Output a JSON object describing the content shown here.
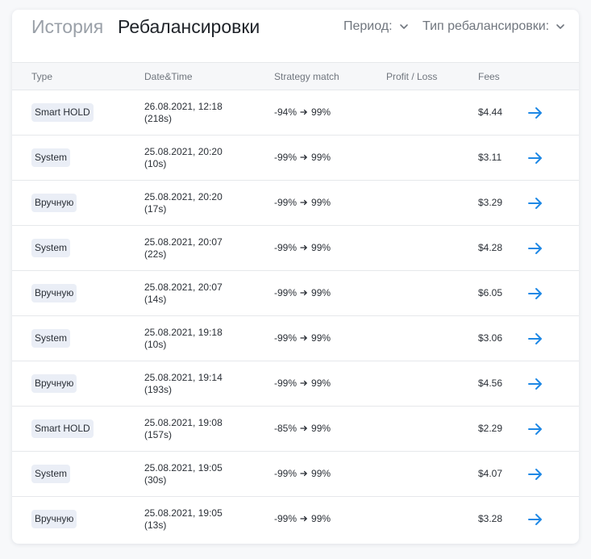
{
  "header": {
    "tab_history": "История",
    "tab_rebalances": "Ребалансировки",
    "filter_period": "Период:",
    "filter_type": "Тип ребалансировки:"
  },
  "columns": {
    "type": "Type",
    "datetime": "Date&Time",
    "strategy_match": "Strategy match",
    "profit_loss": "Profit / Loss",
    "fees": "Fees"
  },
  "colors": {
    "accent": "#1e88e5",
    "badge_bg": "#eaeef6"
  },
  "rows": [
    {
      "type": "Smart HOLD",
      "datetime": "26.08.2021, 12:18",
      "duration": "(218s)",
      "match_from": "-94%",
      "match_to": "99%",
      "profit_loss": "",
      "fees": "$4.44"
    },
    {
      "type": "System",
      "datetime": "25.08.2021, 20:20",
      "duration": "(10s)",
      "match_from": "-99%",
      "match_to": "99%",
      "profit_loss": "",
      "fees": "$3.11"
    },
    {
      "type": "Вручную",
      "datetime": "25.08.2021, 20:20",
      "duration": "(17s)",
      "match_from": "-99%",
      "match_to": "99%",
      "profit_loss": "",
      "fees": "$3.29"
    },
    {
      "type": "System",
      "datetime": "25.08.2021, 20:07",
      "duration": "(22s)",
      "match_from": "-99%",
      "match_to": "99%",
      "profit_loss": "",
      "fees": "$4.28"
    },
    {
      "type": "Вручную",
      "datetime": "25.08.2021, 20:07",
      "duration": "(14s)",
      "match_from": "-99%",
      "match_to": "99%",
      "profit_loss": "",
      "fees": "$6.05"
    },
    {
      "type": "System",
      "datetime": "25.08.2021, 19:18",
      "duration": "(10s)",
      "match_from": "-99%",
      "match_to": "99%",
      "profit_loss": "",
      "fees": "$3.06"
    },
    {
      "type": "Вручную",
      "datetime": "25.08.2021, 19:14",
      "duration": "(193s)",
      "match_from": "-99%",
      "match_to": "99%",
      "profit_loss": "",
      "fees": "$4.56"
    },
    {
      "type": "Smart HOLD",
      "datetime": "25.08.2021, 19:08",
      "duration": "(157s)",
      "match_from": "-85%",
      "match_to": "99%",
      "profit_loss": "",
      "fees": "$2.29"
    },
    {
      "type": "System",
      "datetime": "25.08.2021, 19:05",
      "duration": "(30s)",
      "match_from": "-99%",
      "match_to": "99%",
      "profit_loss": "",
      "fees": "$4.07"
    },
    {
      "type": "Вручную",
      "datetime": "25.08.2021, 19:05",
      "duration": "(13s)",
      "match_from": "-99%",
      "match_to": "99%",
      "profit_loss": "",
      "fees": "$3.28"
    }
  ]
}
